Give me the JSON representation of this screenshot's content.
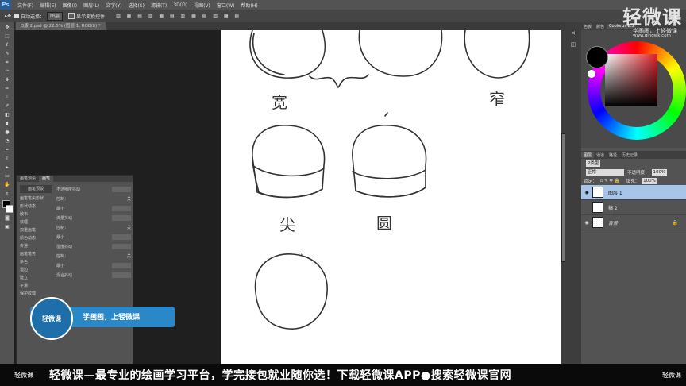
{
  "menubar": {
    "app_logo": "Ps",
    "items": [
      "文件(F)",
      "编辑(E)",
      "图像(I)",
      "图层(L)",
      "文字(Y)",
      "选择(S)",
      "滤镜(T)",
      "3D(D)",
      "视图(V)",
      "窗口(W)",
      "帮助(H)"
    ]
  },
  "options": {
    "auto_select_label": "自动选择：",
    "auto_select_value": "图层",
    "show_transform_label": "显示变换控件"
  },
  "document": {
    "tab_title": "Q版 2.psd @ 22.5% (图层 1, RGB/8) *"
  },
  "brush_panel": {
    "tabs": [
      "画笔预设",
      "画笔"
    ],
    "preset_button": "画笔预设",
    "left_items": [
      "画笔笔尖形状",
      "形状动态",
      "散布",
      "纹理",
      "双重画笔",
      "颜色动态",
      "传递",
      "画笔笔势",
      "杂色",
      "湿边",
      "建立",
      "平滑",
      "保护纹理"
    ],
    "right_labels": [
      "不透明度抖动",
      "控制：",
      "关",
      "最小",
      "流量抖动",
      "控制：",
      "关",
      "最小",
      "湿度抖动",
      "控制：",
      "关",
      "最小",
      "混合抖动"
    ]
  },
  "color_panel": {
    "tabs": [
      "色板",
      "颜色",
      "Coolorus 2.5"
    ]
  },
  "layers_panel": {
    "tabs": [
      "图层",
      "通道",
      "路径",
      "历史记录"
    ],
    "kind_label": "P类型",
    "blend_mode": "正常",
    "opacity_label": "不透明度：",
    "opacity_value": "100%",
    "lock_label": "锁定：",
    "fill_label": "填充：",
    "fill_value": "100%",
    "layers": [
      {
        "name": "图层 1",
        "selected": true,
        "visible": true
      },
      {
        "name": "稿 2",
        "selected": false,
        "visible": false
      },
      {
        "name": "背景",
        "selected": false,
        "visible": true
      }
    ]
  },
  "canvas_labels": {
    "label_wide": "宽",
    "label_narrow": "窄",
    "label_pointed": "尖",
    "label_round": "圆"
  },
  "promo": {
    "badge": "轻微课",
    "text": "学画画，上轻微课"
  },
  "watermark": {
    "title": "轻微课",
    "subtitle": "学画画，上轻微课",
    "url": "www.qingwk.com"
  },
  "banner": {
    "logo": "轻微课",
    "text": "轻微课—最专业的绘画学习平台，学完接包就业随你选！下载轻微课APP●搜索轻微课官网",
    "right": "轻微课"
  },
  "colors": {
    "accent": "#2b88c8",
    "layer_selected": "#a8c4e8"
  }
}
